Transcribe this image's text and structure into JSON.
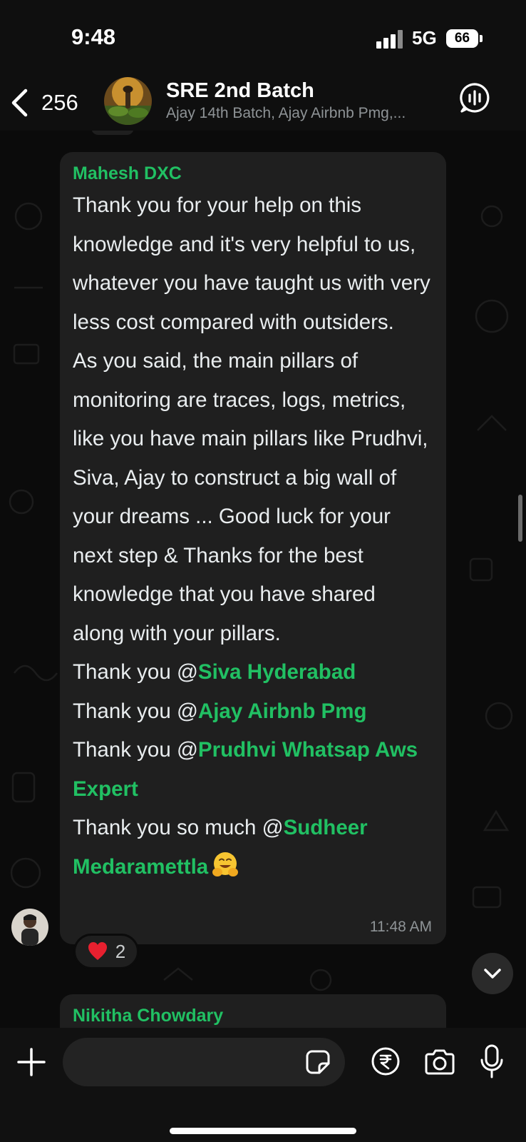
{
  "status_bar": {
    "time": "9:48",
    "network": "5G",
    "battery": "66"
  },
  "header": {
    "back_count": "256",
    "group_name": "SRE 2nd Batch",
    "members": "Ajay 14th Batch, Ajay Airbnb Pmg,..."
  },
  "message": {
    "sender": "Mahesh DXC",
    "paragraph1": "Thank you for your help on this knowledge and it's very helpful to us, whatever you have taught us with very less cost compared with outsiders.",
    "paragraph2": "As you said, the main pillars of monitoring are traces, logs, metrics, like you have main pillars like Prudhvi, Siva, Ajay to construct a big wall of your dreams ... Good luck for your next step & Thanks for the best knowledge that you have shared along with your pillars.",
    "thanks1_prefix": "Thank you @",
    "thanks1_mention": "Siva Hyderabad",
    "thanks2_prefix": "Thank you @",
    "thanks2_mention": "Ajay Airbnb Pmg",
    "thanks3_prefix": "Thank you @",
    "thanks3_mention": "Prudhvi Whatsap Aws Expert",
    "thanks4_prefix": "Thank you so much @",
    "thanks4_mention": "Sudheer Medaramettla",
    "emoji": "hugging-face",
    "time": "11:48 AM",
    "reaction_emoji": "heart",
    "reaction_count": "2"
  },
  "next_message": {
    "sender": "Nikitha Chowdary"
  },
  "colors": {
    "accent": "#21c063",
    "bubble": "#1f1f1f",
    "background": "#0b0b0b"
  }
}
